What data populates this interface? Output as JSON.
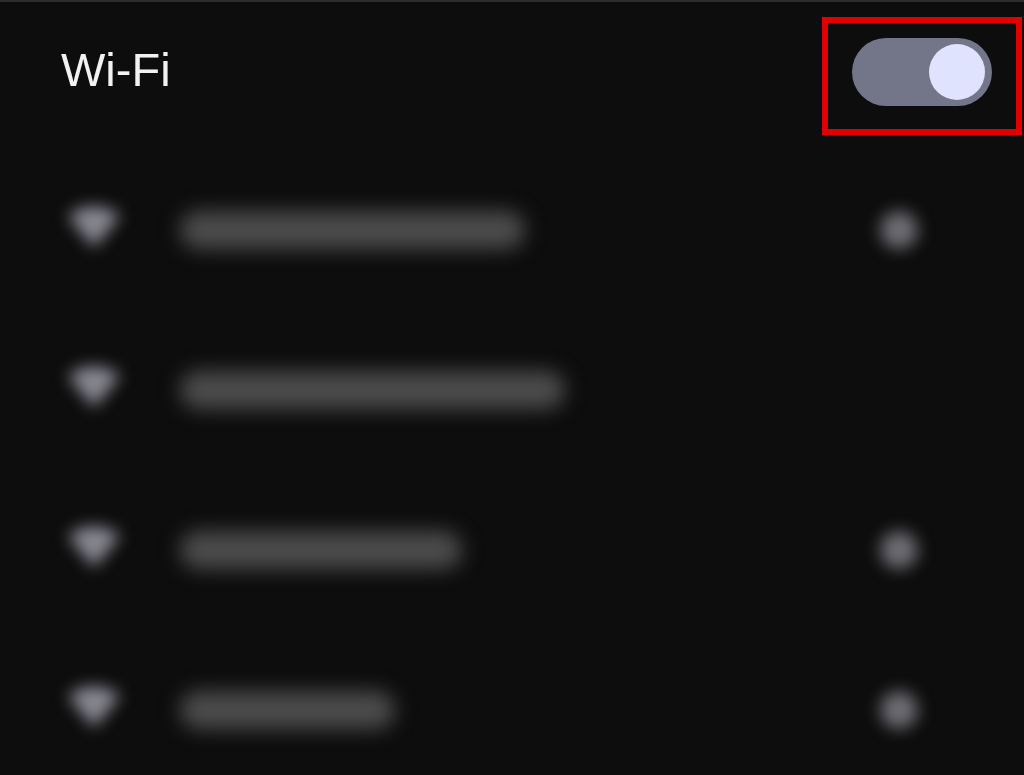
{
  "wifi": {
    "title": "Wi-Fi",
    "on": true,
    "highlighted": true
  },
  "networks": [
    {
      "secured": true
    },
    {
      "secured": false
    },
    {
      "secured": true
    },
    {
      "secured": true
    }
  ]
}
